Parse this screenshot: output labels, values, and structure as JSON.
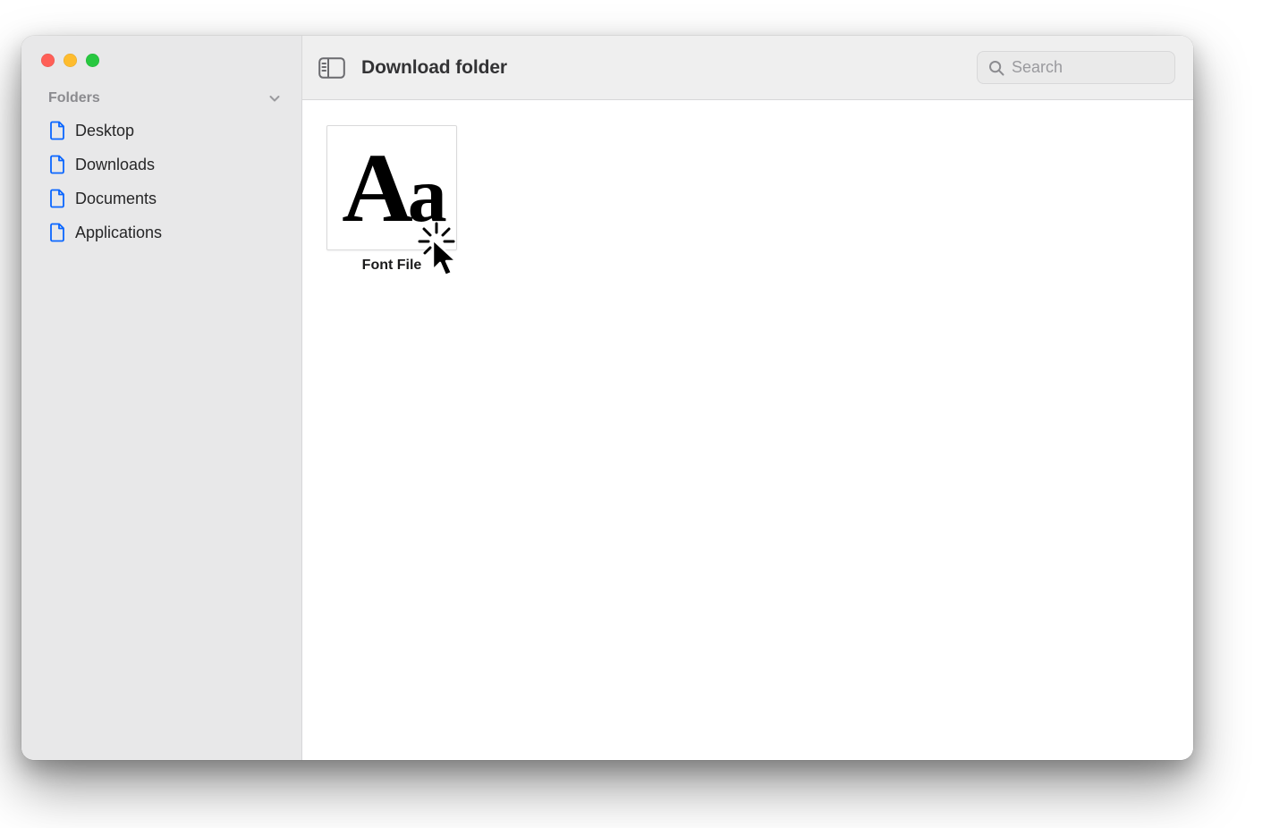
{
  "window": {
    "title": "Download folder"
  },
  "sidebar": {
    "section_label": "Folders",
    "items": [
      {
        "label": "Desktop"
      },
      {
        "label": "Downloads"
      },
      {
        "label": "Documents"
      },
      {
        "label": "Applications"
      }
    ]
  },
  "search": {
    "placeholder": "Search",
    "value": ""
  },
  "content": {
    "files": [
      {
        "label": "Font File",
        "thumb_text_upper": "A",
        "thumb_text_lower": "a"
      }
    ]
  },
  "colors": {
    "icon_blue": "#0a66ff",
    "toolbar_bg": "#efefef",
    "sidebar_bg": "#e8e8e9"
  }
}
